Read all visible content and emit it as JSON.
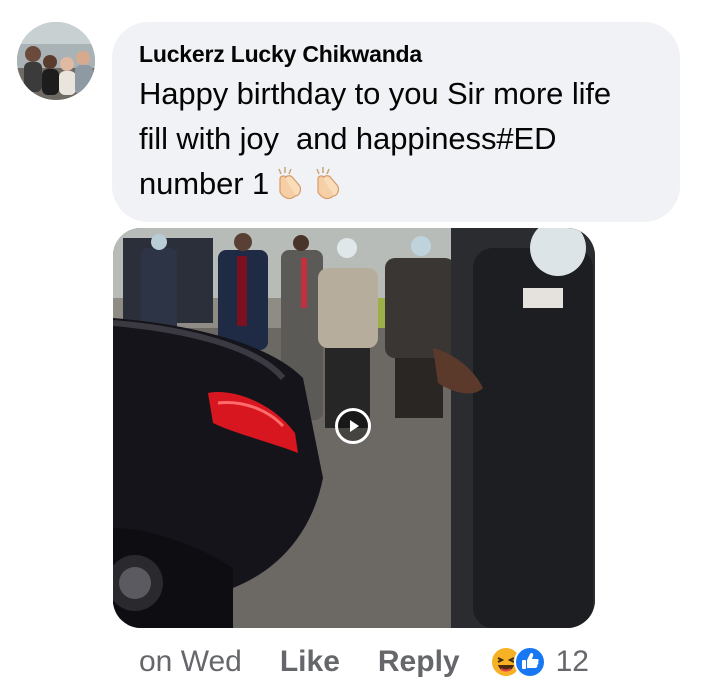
{
  "comment": {
    "author": "Luckerz Lucky Chikwanda",
    "text_lines": [
      "Happy birthday to you Sir more life",
      "fill with joy  and happiness#ED",
      "number 1"
    ],
    "trailing_emojis": [
      "clapping-hands",
      "clapping-hands"
    ]
  },
  "attachment": {
    "type": "video",
    "overlay_icon": "play-icon"
  },
  "footer": {
    "timestamp": "on Wed",
    "like_label": "Like",
    "reply_label": "Reply",
    "reactions": [
      "haha",
      "like"
    ],
    "reaction_count": "12"
  },
  "colors": {
    "bubble_bg": "#f0f2f5",
    "text": "#050505",
    "secondary_text": "#65676b",
    "like_blue": "#1877f2",
    "haha_yellow": "#f7b125"
  }
}
